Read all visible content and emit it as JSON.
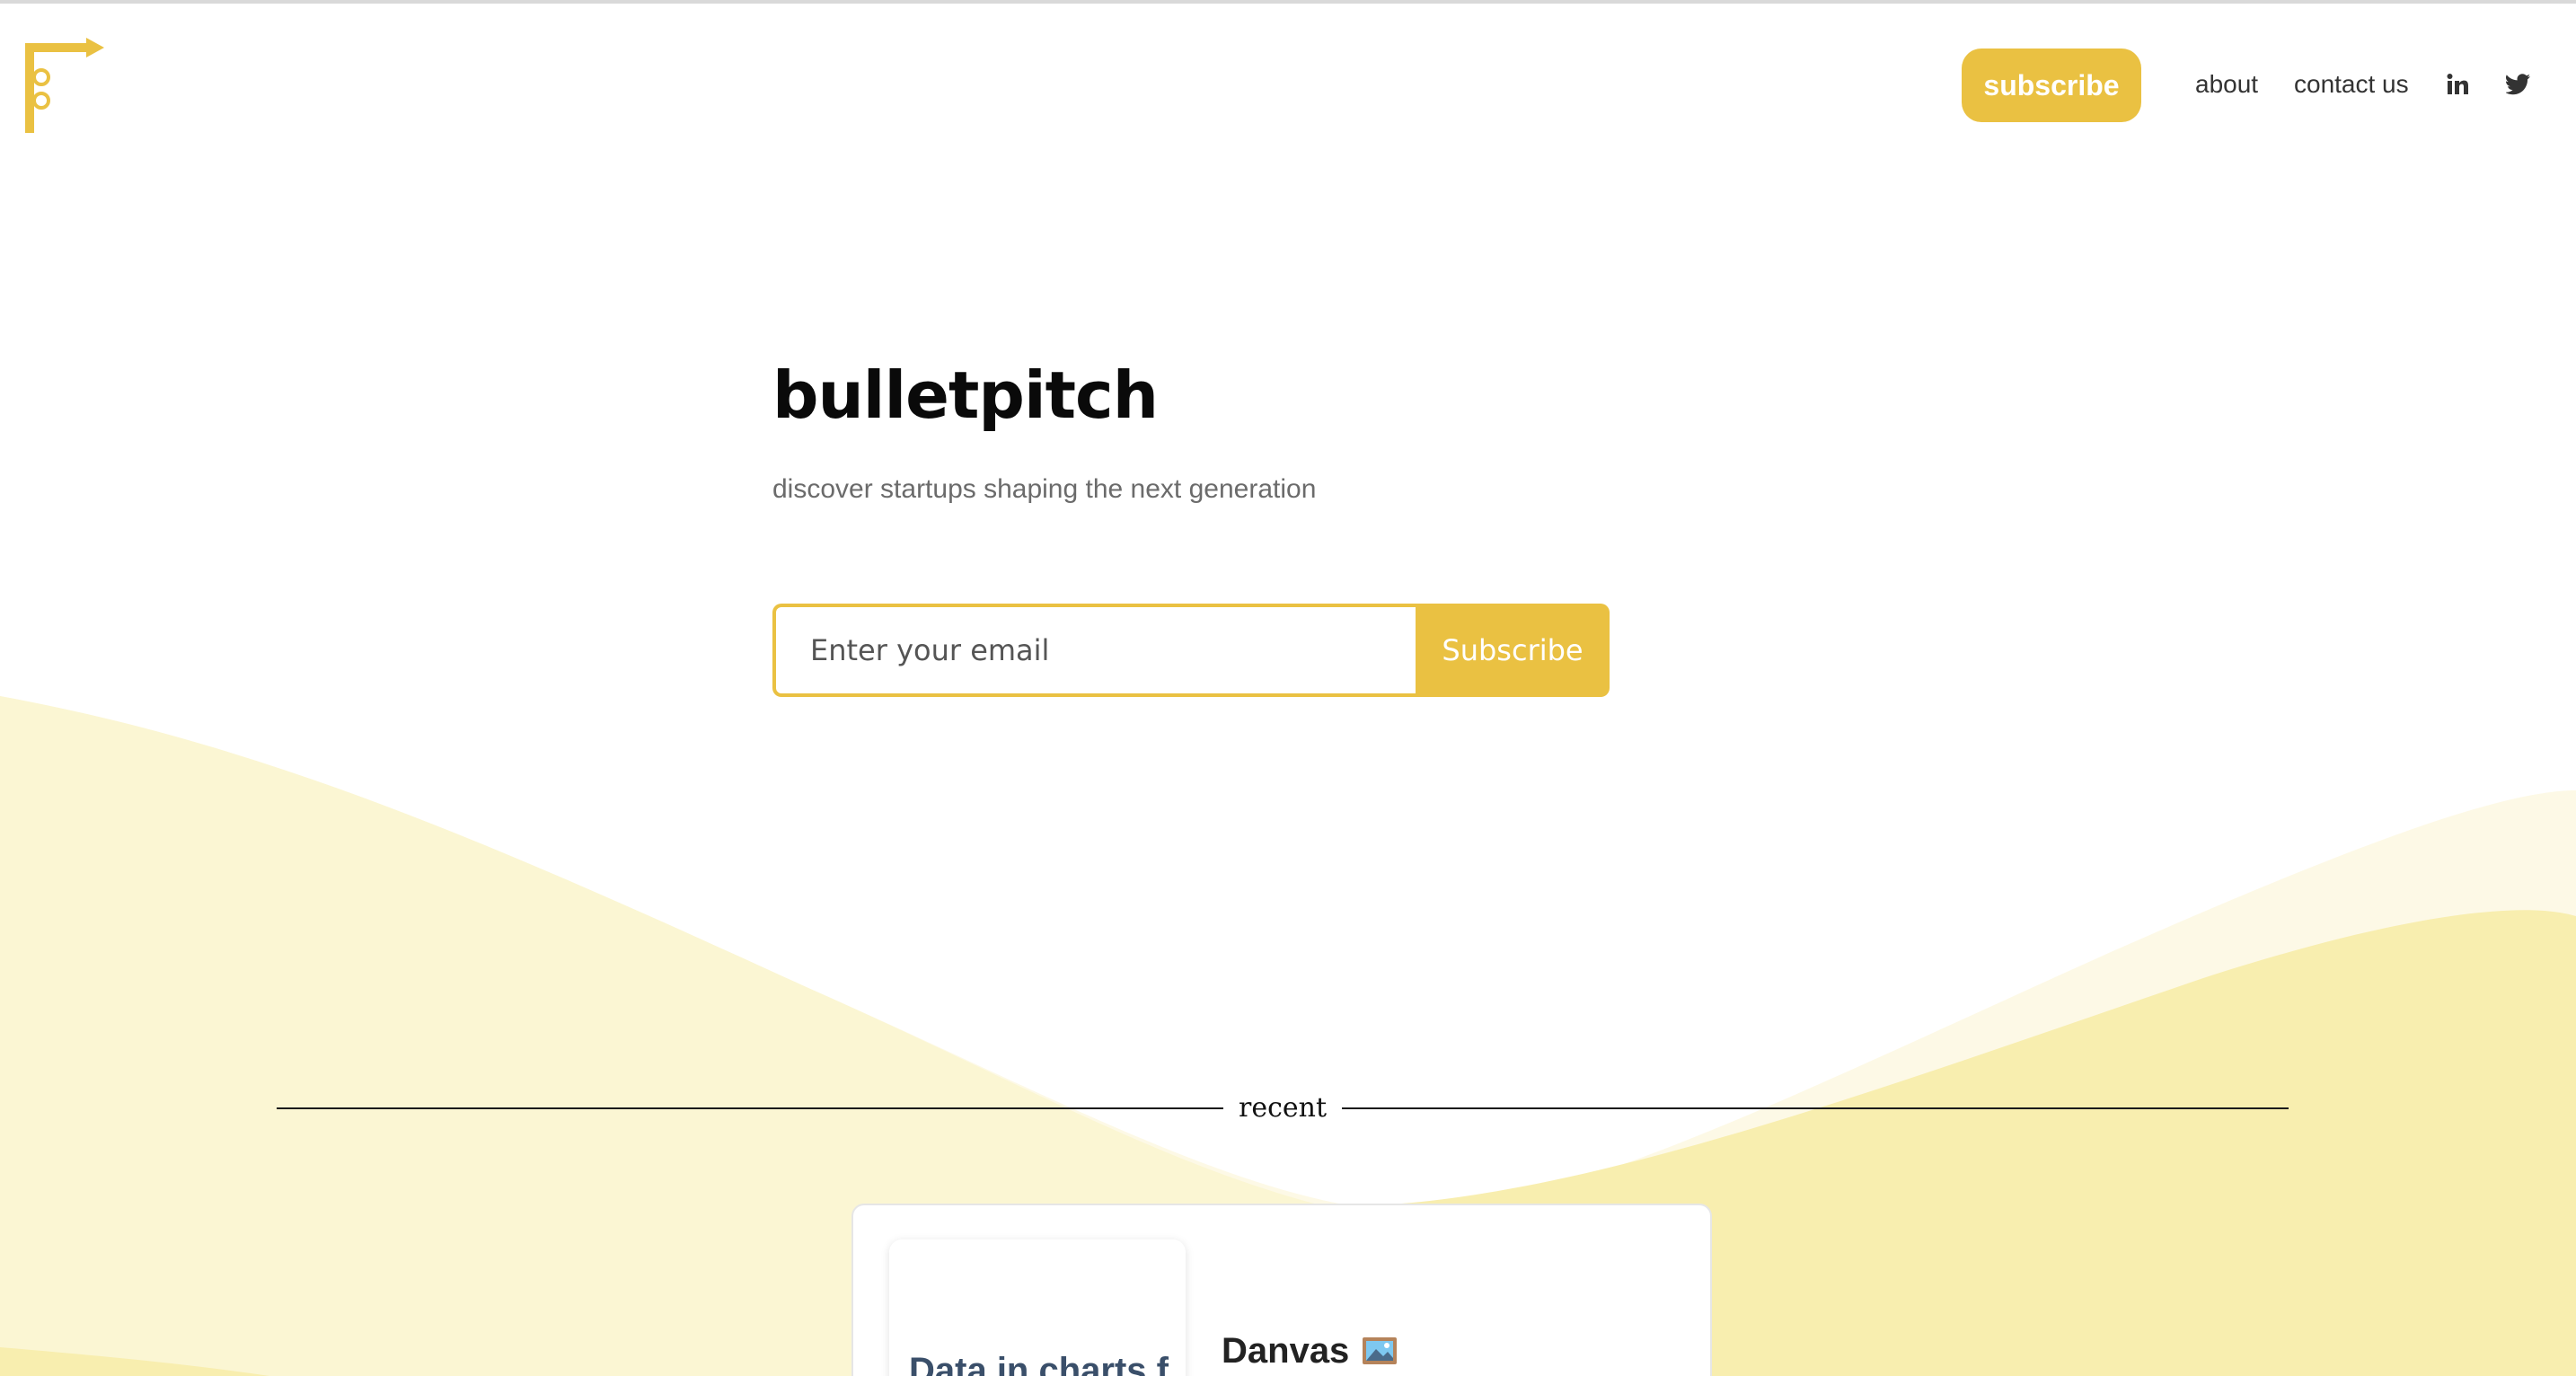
{
  "colors": {
    "accent": "#eac142",
    "wave_light": "#fbf6d3",
    "wave_lighter": "#fdf9e6",
    "wave_mid": "#f8eeaf"
  },
  "logo": {
    "icon": "bulletpitch-logo-icon"
  },
  "nav": {
    "subscribe_label": "subscribe",
    "about_label": "about",
    "contact_label": "contact us",
    "linkedin_icon": "linkedin-icon",
    "twitter_icon": "twitter-icon"
  },
  "hero": {
    "title": "bulletpitch",
    "subtitle": "discover startups shaping the next generation"
  },
  "signup": {
    "email_placeholder": "Enter your email",
    "email_value": "",
    "button_label": "Subscribe"
  },
  "recent": {
    "label": "recent",
    "cards": [
      {
        "title": "Danvas",
        "title_icon": "framed-picture-icon",
        "thumbnail_text": "Data in charts f"
      }
    ]
  }
}
